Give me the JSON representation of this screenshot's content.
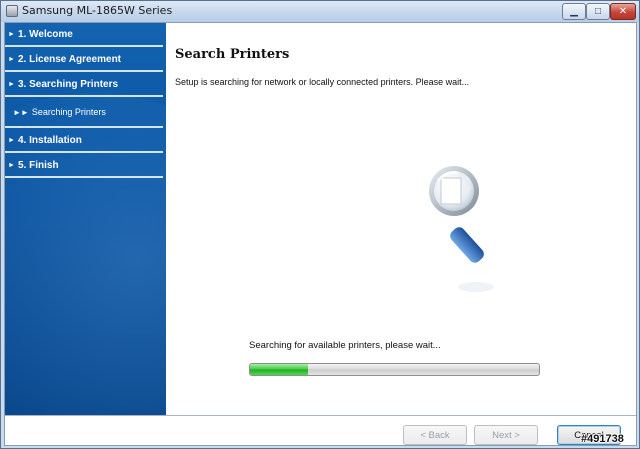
{
  "window": {
    "title": "Samsung ML-1865W Series",
    "minimize_glyph": "▁",
    "maximize_glyph": "□",
    "close_glyph": "✕"
  },
  "sidebar": {
    "bullet": "►",
    "sub_bullet": "►►",
    "steps": [
      {
        "label": "1. Welcome"
      },
      {
        "label": "2. License Agreement"
      },
      {
        "label": "3. Searching Printers"
      },
      {
        "label": "Searching Printers"
      },
      {
        "label": "4. Installation"
      },
      {
        "label": "5. Finish"
      }
    ]
  },
  "main": {
    "title": "Search Printers",
    "description": "Setup is searching for network or locally connected printers. Please wait...",
    "status": "Searching for available printers, please wait...",
    "progress_percent": 20,
    "icon": "magnifier-icon"
  },
  "footer": {
    "back_label": "< Back",
    "next_label": "Next >",
    "cancel_label": "Cancel"
  },
  "watermark": "#491738",
  "colors": {
    "sidebar": "#0b57a5",
    "progress": "#3cc83c"
  }
}
